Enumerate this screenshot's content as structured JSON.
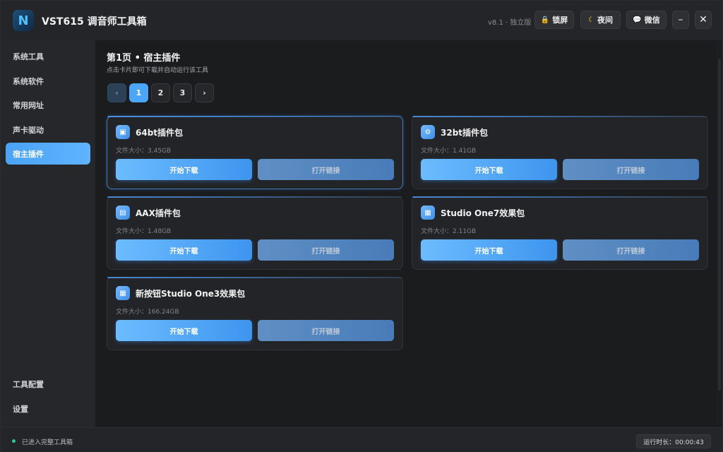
{
  "app": {
    "logo_letter": "N",
    "title": "VST615 调音师工具箱",
    "version": "v8.1 · 独立版"
  },
  "titlebar": {
    "lock": {
      "icon": "lock-icon",
      "label": "锁屏"
    },
    "night": {
      "icon": "moon-icon",
      "label": "夜间"
    },
    "wechat": {
      "icon": "chat-bubble-icon",
      "label": "微信"
    },
    "minimize": "–",
    "close": "✕"
  },
  "sidebar": {
    "items": [
      {
        "label": "系统工具",
        "active": false
      },
      {
        "label": "系统软件",
        "active": false
      },
      {
        "label": "常用网址",
        "active": false
      },
      {
        "label": "声卡驱动",
        "active": false
      },
      {
        "label": "宿主插件",
        "active": true
      }
    ],
    "bottom": [
      {
        "label": "工具配置"
      },
      {
        "label": "设置"
      }
    ]
  },
  "main": {
    "title": "第1页 • 宿主插件",
    "subtitle": "点击卡片即可下载并自动运行该工具"
  },
  "pager": {
    "prev": "‹",
    "pages": [
      "1",
      "2",
      "3"
    ],
    "current": "1",
    "next": "›"
  },
  "cards": [
    {
      "title": "64bt插件包",
      "size": "文件大小：3.45GB",
      "icon": "window-icon",
      "download": "开始下载",
      "open": "打开链接"
    },
    {
      "title": "32bt插件包",
      "size": "文件大小：1.41GB",
      "icon": "gear-icon",
      "download": "开始下载",
      "open": "打开链接"
    },
    {
      "title": "AAX插件包",
      "size": "文件大小：1.48GB",
      "icon": "document-icon",
      "download": "开始下载",
      "open": "打开链接"
    },
    {
      "title": "Studio One7效果包",
      "size": "文件大小：2.11GB",
      "icon": "grid-icon",
      "download": "开始下载",
      "open": "打开链接"
    },
    {
      "title": "新按钮Studio One3效果包",
      "size": "文件大小：166.24GB",
      "icon": "grid-icon",
      "download": "开始下载",
      "open": "打开链接"
    }
  ],
  "status": {
    "text": "已进入完整工具箱",
    "runtime": "运行时长：00:00:43"
  },
  "colors": {
    "accent": "#4ba6f7",
    "status_ok": "#35c48a"
  }
}
